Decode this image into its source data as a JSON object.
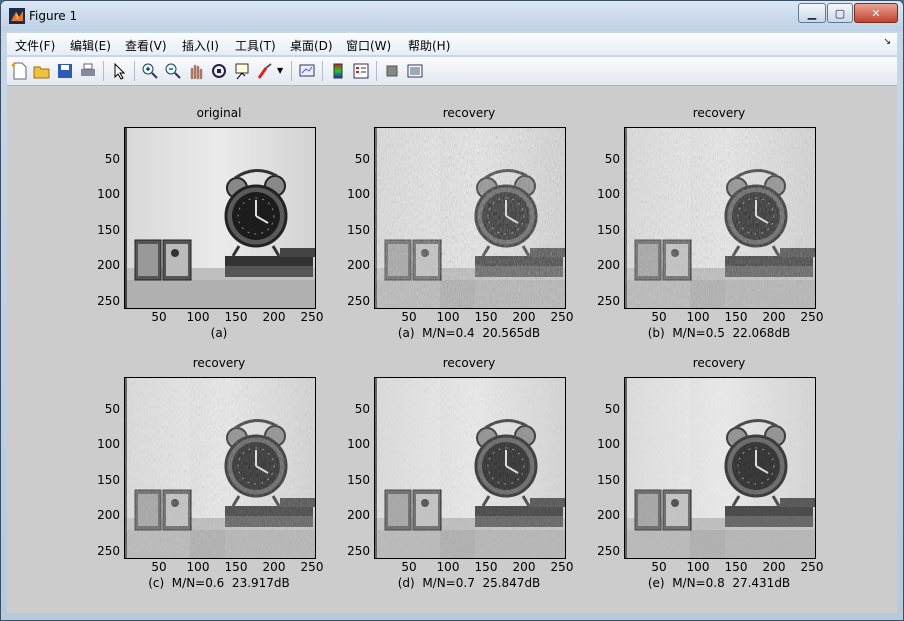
{
  "window": {
    "title": "Figure 1",
    "minimize_icon": "minimize-icon",
    "maximize_icon": "maximize-icon",
    "close_icon": "close-icon"
  },
  "menu": {
    "items": [
      "文件(F)",
      "编辑(E)",
      "查看(V)",
      "插入(I)",
      "工具(T)",
      "桌面(D)",
      "窗口(W)",
      "帮助(H)"
    ],
    "overflow_icon": "menu-arrow-icon"
  },
  "toolbar": {
    "icons": [
      "new-figure-icon",
      "open-icon",
      "save-icon",
      "print-icon",
      "pointer-icon",
      "zoom-in-icon",
      "zoom-out-icon",
      "pan-icon",
      "rotate-3d-icon",
      "data-cursor-icon",
      "brush-icon",
      "link-plot-icon",
      "colorbar-icon",
      "legend-icon",
      "hide-plot-tools-icon",
      "show-plot-tools-icon"
    ]
  },
  "subplots": [
    {
      "title": "original",
      "xlabel": "(a)"
    },
    {
      "title": "recovery",
      "xlabel": "(a)  M/N=0.4  20.565dB"
    },
    {
      "title": "recovery",
      "xlabel": "(b)  M/N=0.5  22.068dB"
    },
    {
      "title": "recovery",
      "xlabel": "(c)  M/N=0.6  23.917dB"
    },
    {
      "title": "recovery",
      "xlabel": "(d)  M/N=0.7  25.847dB"
    },
    {
      "title": "recovery",
      "xlabel": "(e)  M/N=0.8  27.431dB"
    }
  ],
  "axes": {
    "yticks": [
      "50",
      "100",
      "150",
      "200",
      "250"
    ],
    "xticks": [
      "50",
      "100",
      "150",
      "200",
      "250"
    ]
  },
  "colors": {
    "figure_bg": "#cccccc",
    "titlebar": "#c9d8e8"
  }
}
